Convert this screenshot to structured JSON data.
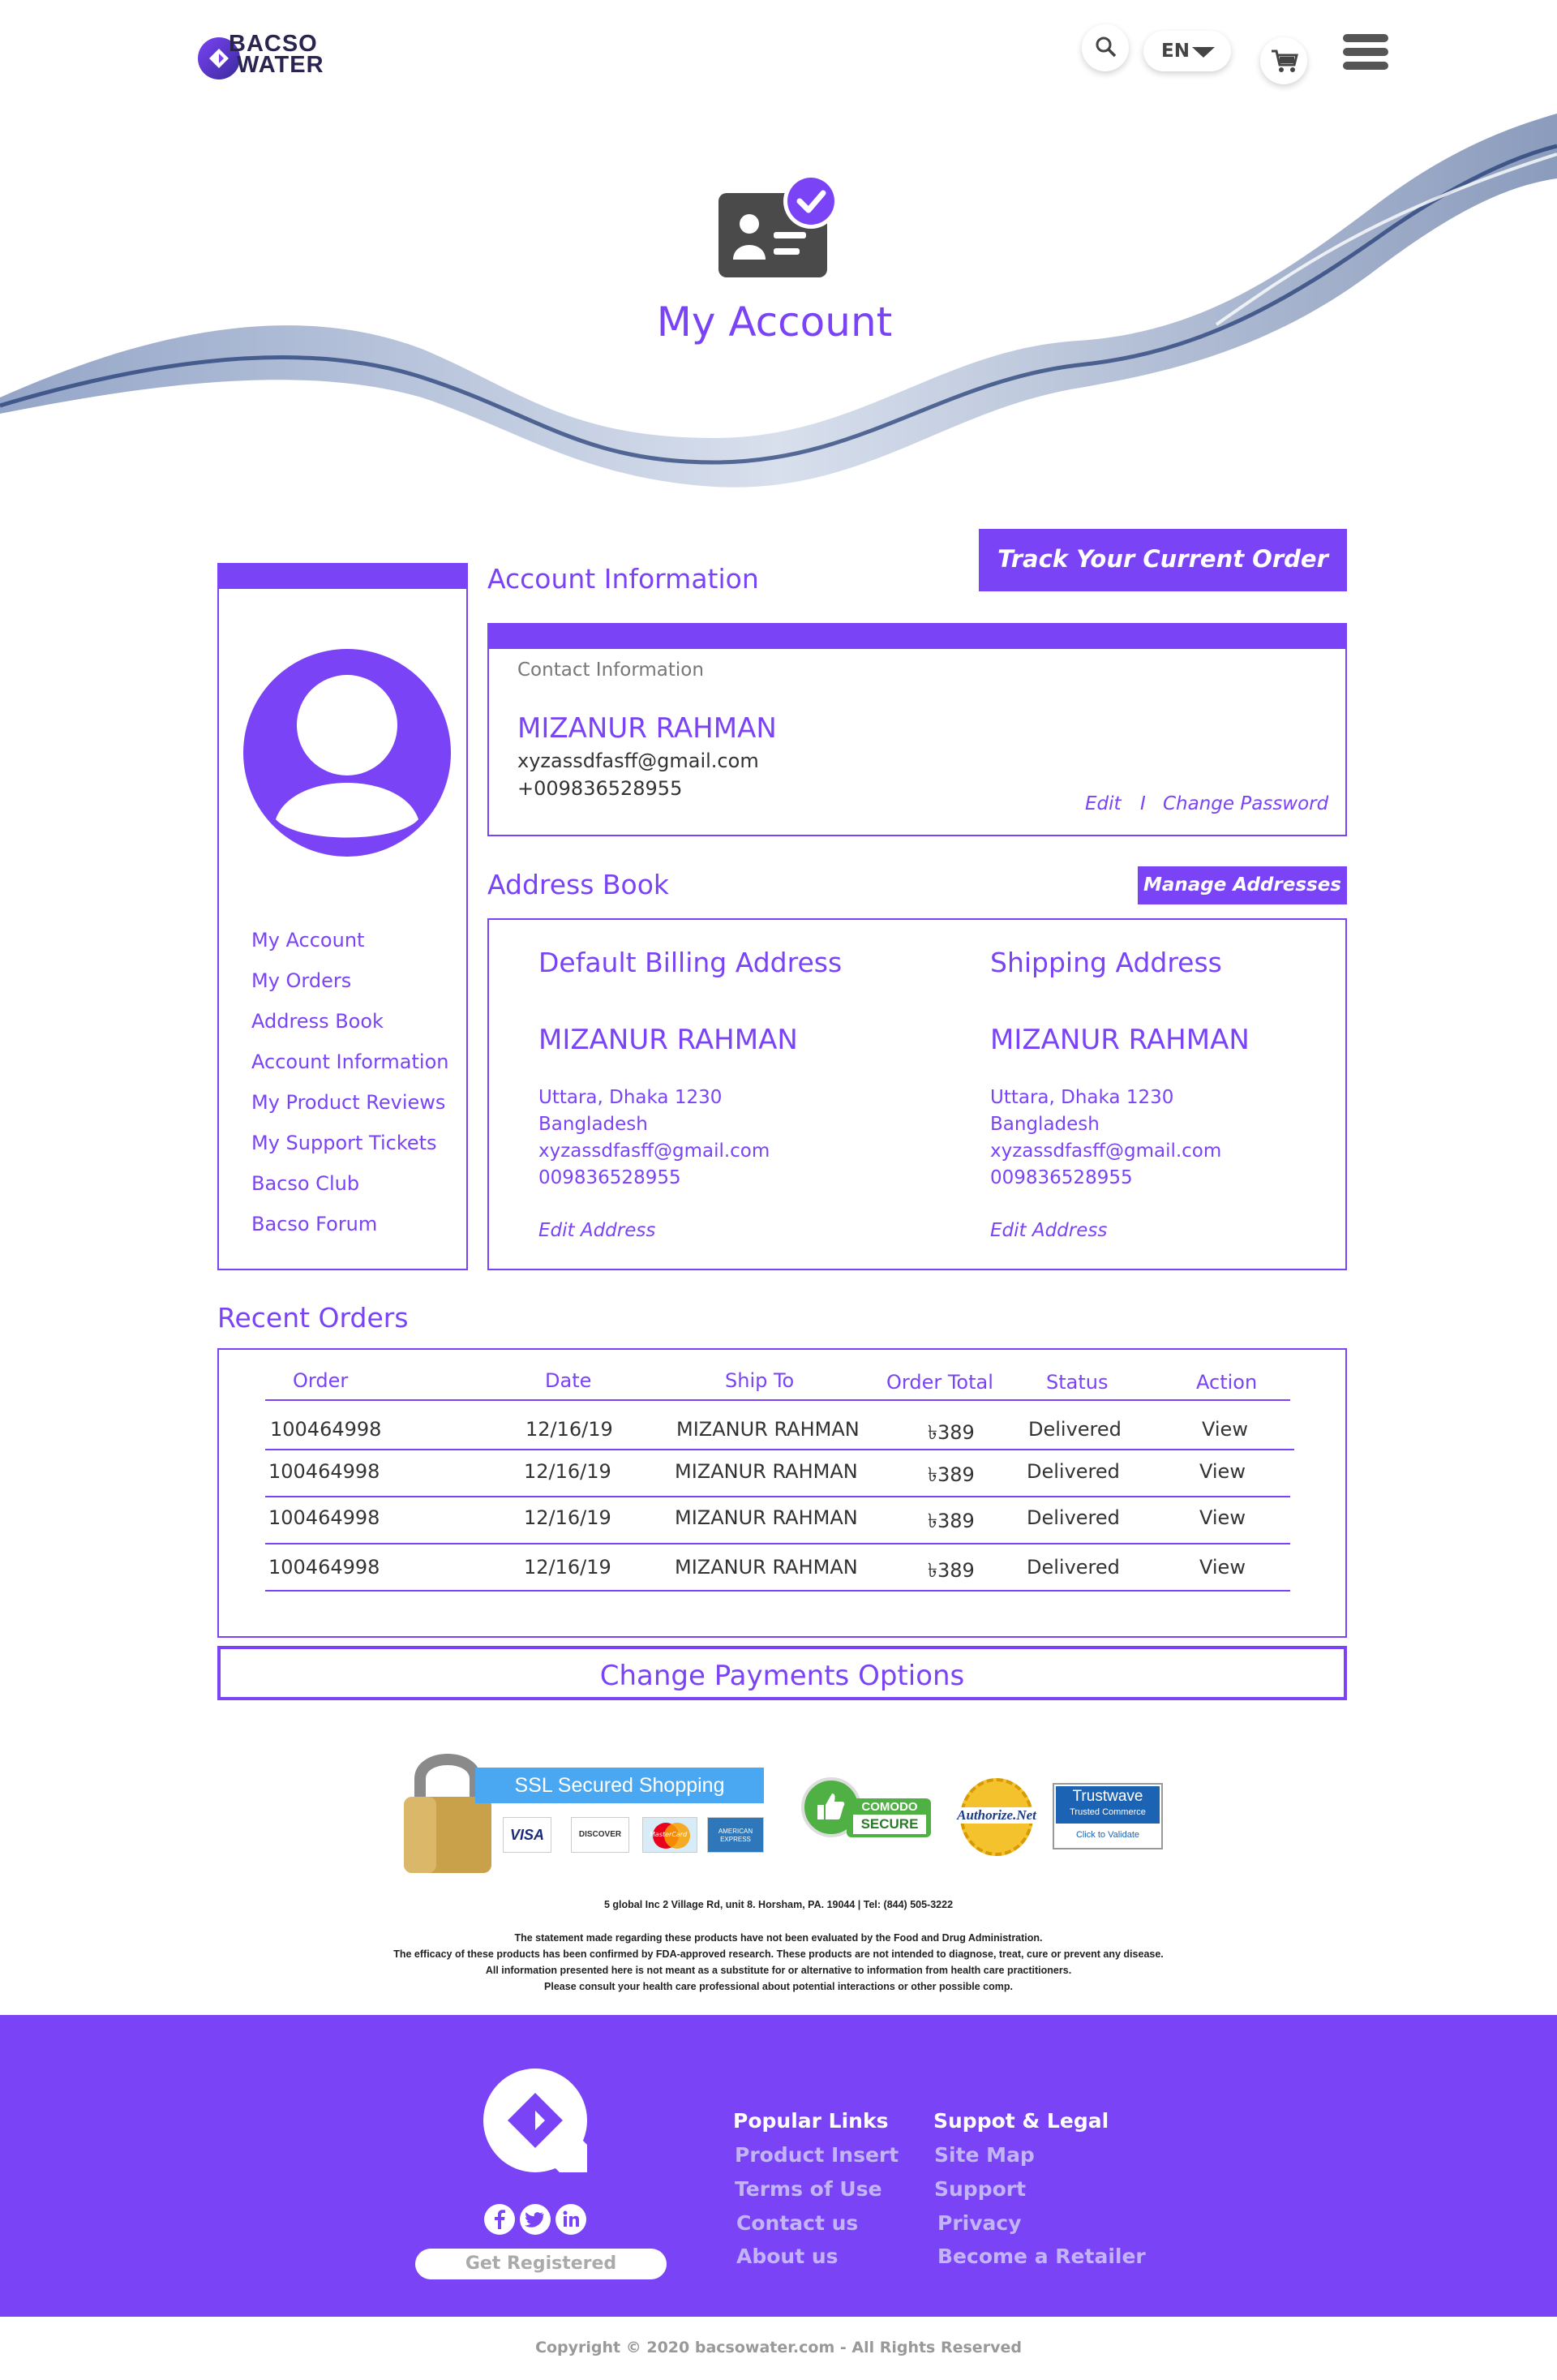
{
  "brand": {
    "line1": "BACSO",
    "line2": "WATER"
  },
  "header": {
    "language": "EN"
  },
  "hero": {
    "title": "My Account"
  },
  "sidebar": {
    "items": [
      "My Account",
      "My Orders",
      "Address Book",
      "Account Information",
      "My Product Reviews",
      "My Support Tickets",
      "Bacso Club",
      "Bacso Forum"
    ]
  },
  "account": {
    "section_title": "Account Information",
    "track_button": "Track Your Current Order",
    "contact_label": "Contact Information",
    "name": "MIZANUR RAHMAN",
    "email": "xyzassdfasff@gmail.com",
    "phone": "+009836528955",
    "edit": "Edit",
    "separator": "I",
    "change_password": "Change Password"
  },
  "address_book": {
    "title": "Address Book",
    "manage_button": "Manage Addresses",
    "billing": {
      "heading": "Default Billing Address",
      "name": "MIZANUR RAHMAN",
      "line1": "Uttara, Dhaka 1230",
      "line2": "Bangladesh",
      "email": "xyzassdfasff@gmail.com",
      "phone": "009836528955",
      "edit": "Edit Address"
    },
    "shipping": {
      "heading": "Shipping Address",
      "name": "MIZANUR RAHMAN",
      "line1": "Uttara, Dhaka 1230",
      "line2": "Bangladesh",
      "email": "xyzassdfasff@gmail.com",
      "phone": "009836528955",
      "edit": "Edit Address"
    }
  },
  "orders": {
    "title": "Recent Orders",
    "columns": [
      "Order",
      "Date",
      "Ship To",
      "Order Total",
      "Status",
      "Action"
    ],
    "rows": [
      {
        "order": "100464998",
        "date": "12/16/19",
        "ship_to": "MIZANUR RAHMAN",
        "total": "৳389",
        "status": "Delivered",
        "action": "View"
      },
      {
        "order": "100464998",
        "date": "12/16/19",
        "ship_to": "MIZANUR RAHMAN",
        "total": "৳389",
        "status": "Delivered",
        "action": "View"
      },
      {
        "order": "100464998",
        "date": "12/16/19",
        "ship_to": "MIZANUR RAHMAN",
        "total": "৳389",
        "status": "Delivered",
        "action": "View"
      },
      {
        "order": "100464998",
        "date": "12/16/19",
        "ship_to": "MIZANUR RAHMAN",
        "total": "৳389",
        "status": "Delivered",
        "action": "View"
      }
    ]
  },
  "payments_button": "Change Payments Options",
  "badges": {
    "ssl": "SSL Secured Shopping",
    "cards": [
      "VISA",
      "DISCOVER",
      "MasterCard",
      "AMERICAN EXPRESS"
    ],
    "comodo": [
      "COMODO",
      "SECURE"
    ],
    "authorize": "Authorize.Net",
    "trustwave": [
      "Trustwave",
      "Trusted Commerce",
      "Click to Validate"
    ]
  },
  "address_line": "5 global Inc 2 Village Rd, unit 8. Horsham, PA. 19044 | Tel: (844) 505-3222",
  "disclaimer": [
    "The statement made regarding these products have not been evaluated by the Food and Drug Administration.",
    "The efficacy of these products has been confirmed by FDA-approved research. These products are not intended to diagnose, treat, cure or prevent any disease.",
    "All information presented here is not meant as a substitute for or alternative to information from health care practitioners.",
    "Please consult your health care professional about potential interactions or other possible comp."
  ],
  "footer": {
    "register_button": "Get Registered",
    "popular_title": "Popular Links",
    "popular_links": [
      "Product Insert",
      "Terms of Use",
      "Contact us",
      "About us"
    ],
    "support_title": "Suppot & Legal",
    "support_links": [
      "Site Map",
      "Support",
      "Privacy",
      "Become a Retailer"
    ],
    "copyright": "Copyright © 2020 bacsowater.com - All Rights Reserved"
  },
  "colors": {
    "accent": "#7a43f5",
    "footer_bg": "#7a43f5",
    "text": "#333333"
  }
}
